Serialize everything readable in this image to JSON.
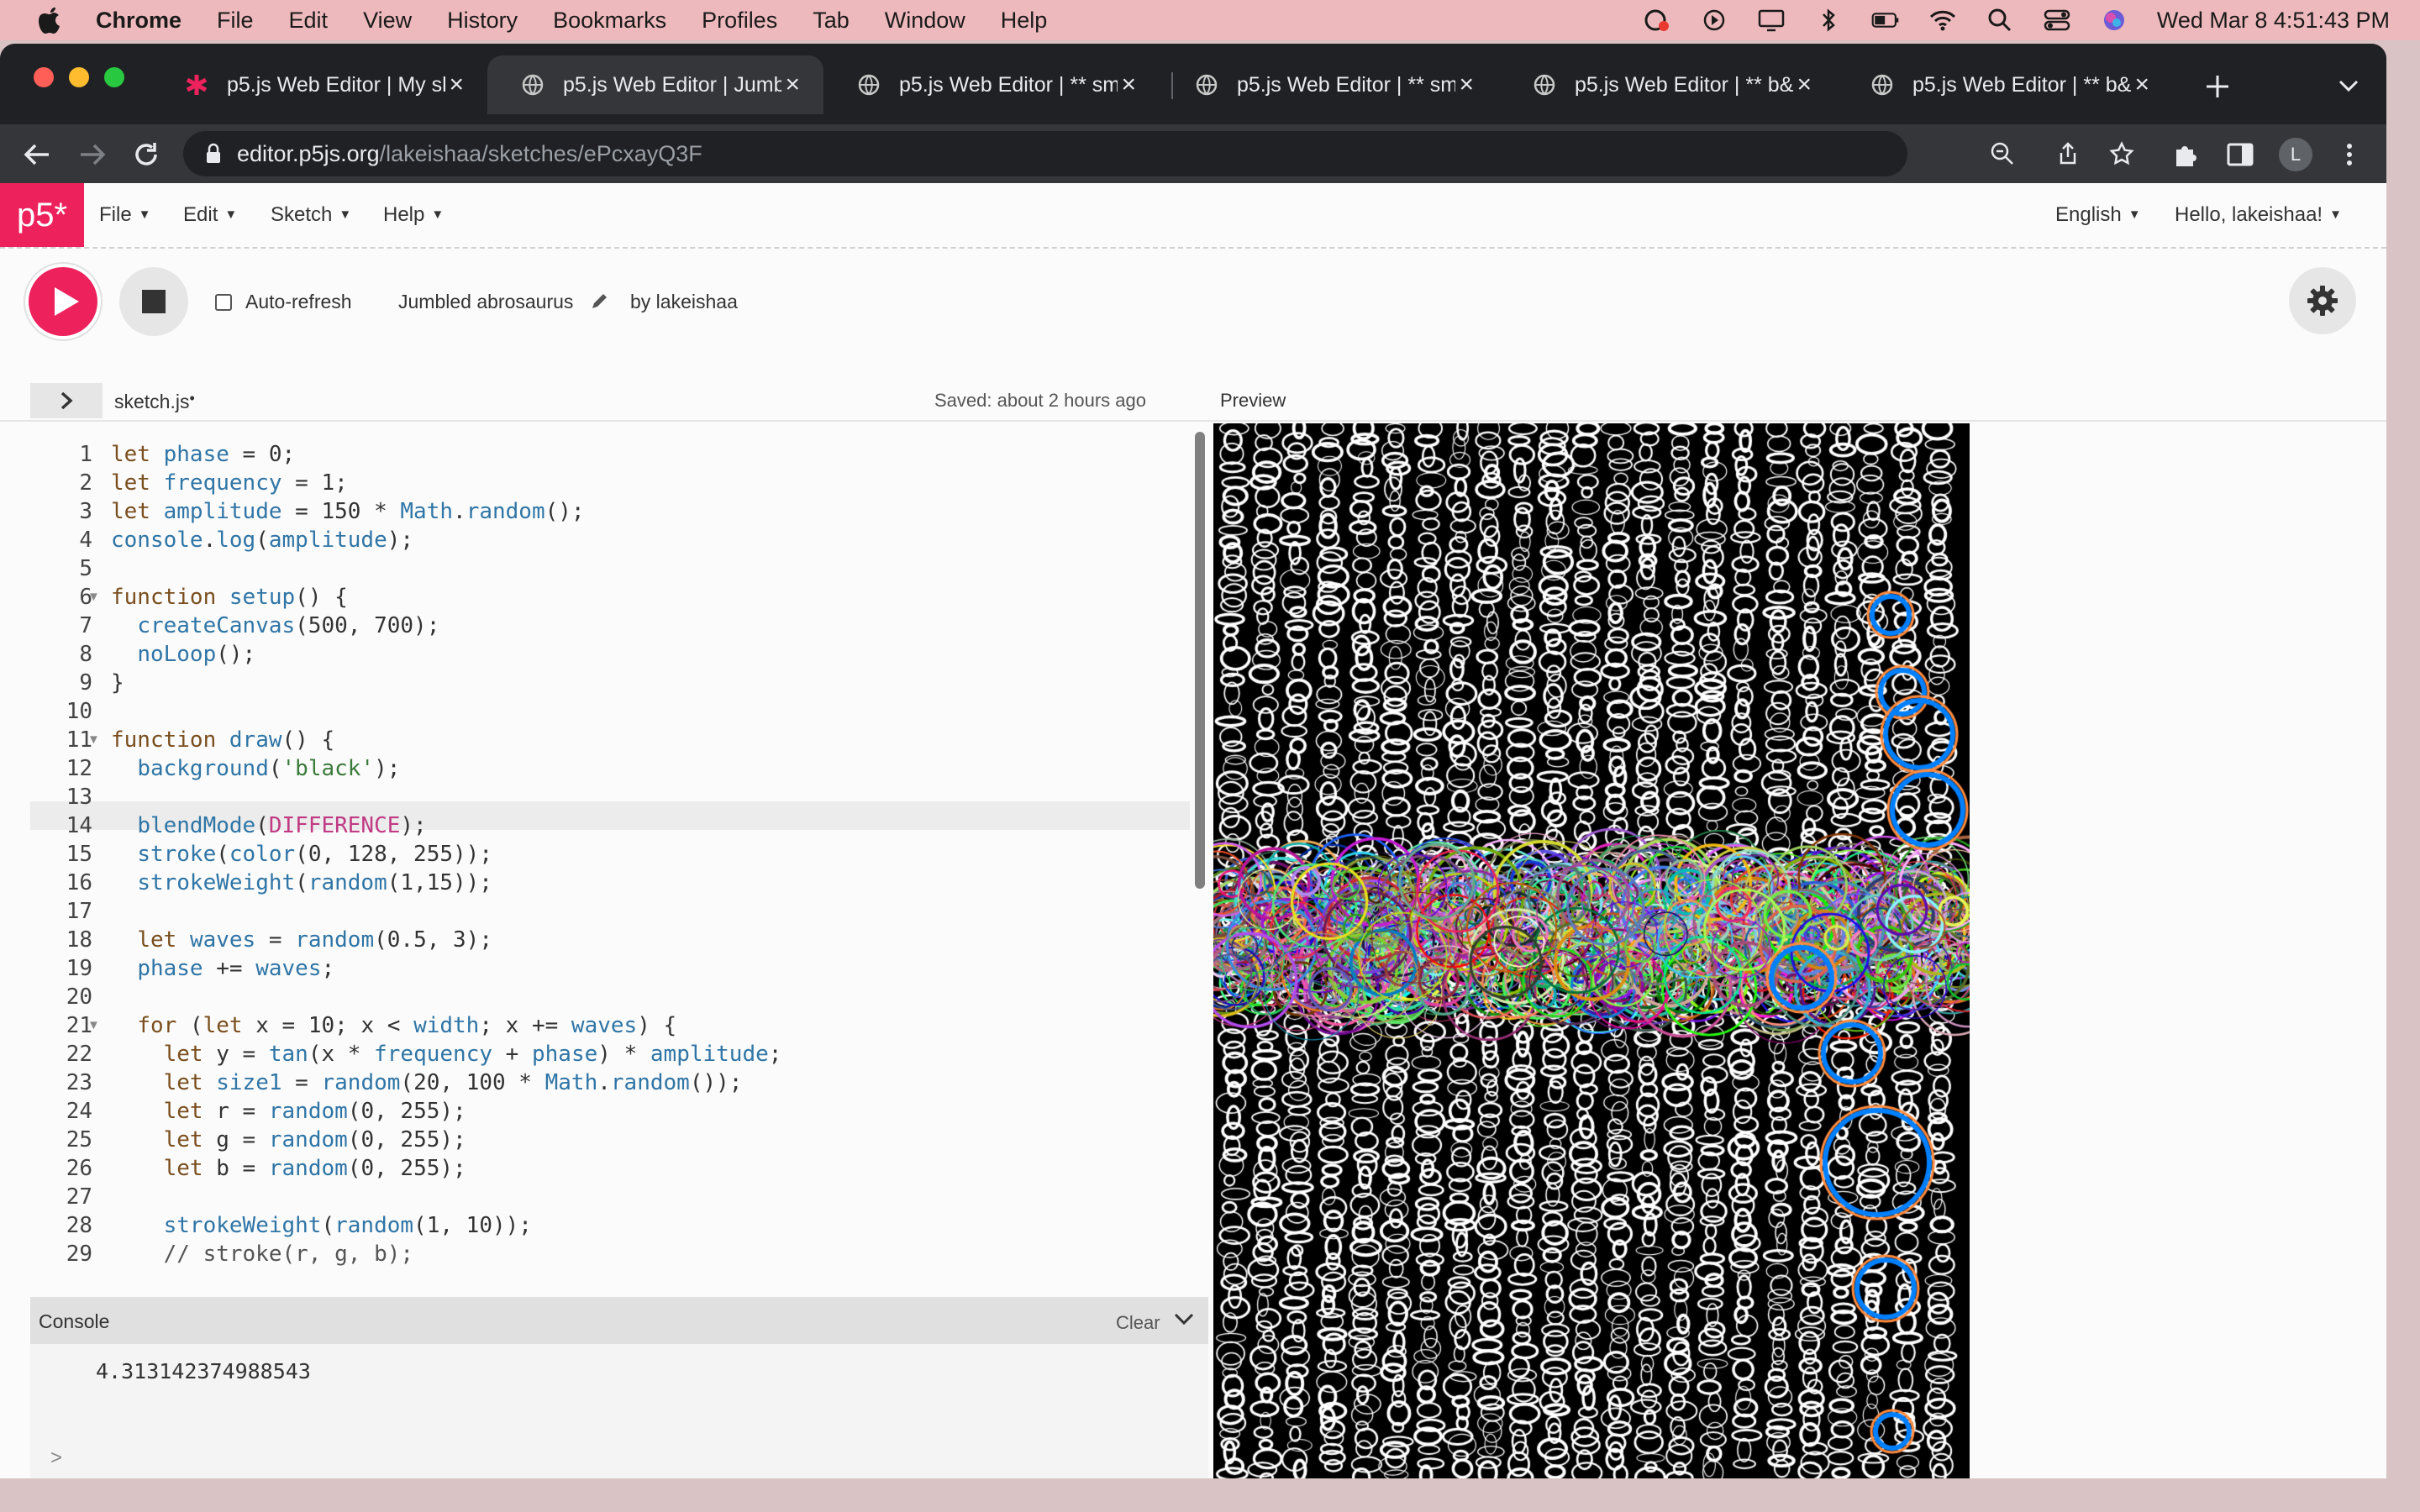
{
  "menubar": {
    "app_name": "Chrome",
    "items": [
      "File",
      "Edit",
      "View",
      "History",
      "Bookmarks",
      "Profiles",
      "Tab",
      "Window",
      "Help"
    ],
    "clock": "Wed Mar 8  4:51:43 PM"
  },
  "tabs": [
    {
      "title": "p5.js Web Editor | My sk",
      "icon": "p5-asterisk-icon",
      "active": false
    },
    {
      "title": "p5.js Web Editor | Jumbl",
      "icon": "globe-icon",
      "active": true
    },
    {
      "title": "p5.js Web Editor | ** sm",
      "icon": "globe-icon",
      "active": false
    },
    {
      "title": "p5.js Web Editor | ** sm",
      "icon": "globe-icon",
      "active": false
    },
    {
      "title": "p5.js Web Editor | ** b&",
      "icon": "globe-icon",
      "active": false
    },
    {
      "title": "p5.js Web Editor | ** b&",
      "icon": "globe-icon",
      "active": false
    }
  ],
  "toolbar": {
    "url_host": "editor.p5js.org",
    "url_path": "/lakeishaa/sketches/ePcxayQ3F",
    "profile_initial": "L"
  },
  "editor_nav": {
    "logo": "p5*",
    "menus": [
      "File",
      "Edit",
      "Sketch",
      "Help"
    ],
    "language": "English",
    "greeting": "Hello, lakeishaa!"
  },
  "controls": {
    "auto_refresh_label": "Auto-refresh",
    "sketch_name": "Jumbled abrosaurus",
    "by_label": "by lakeishaa"
  },
  "filebar": {
    "filename": "sketch.js",
    "unsaved_dot": "•",
    "saved_text": "Saved: about 2 hours ago",
    "preview_label": "Preview"
  },
  "code_lines": [
    "let phase = 0;",
    "let frequency = 1;",
    "let amplitude = 150 * Math.random();",
    "console.log(amplitude);",
    "",
    "function setup() {",
    "  createCanvas(500, 700);",
    "  noLoop();",
    "}",
    "",
    "function draw() {",
    "  background('black');",
    "",
    "  blendMode(DIFFERENCE);",
    "  stroke(color(0, 128, 255));",
    "  strokeWeight(random(1,15));",
    "",
    "  let waves = random(0.5, 3);",
    "  phase += waves;",
    "",
    "  for (let x = 10; x < width; x += waves) {",
    "    let y = tan(x * frequency + phase) * amplitude;",
    "    let size1 = random(20, 100 * Math.random());",
    "    let r = random(0, 255);",
    "    let g = random(0, 255);",
    "    let b = random(0, 255);",
    "",
    "    strokeWeight(random(1, 10));",
    "    // stroke(r, g, b);"
  ],
  "console": {
    "title": "Console",
    "clear_label": "Clear",
    "output": "4.313142374988543",
    "prompt": ">"
  },
  "colors": {
    "p5_pink": "#ed225d",
    "canvas_bg": "#000000",
    "stroke_blue": "#0080ff"
  }
}
